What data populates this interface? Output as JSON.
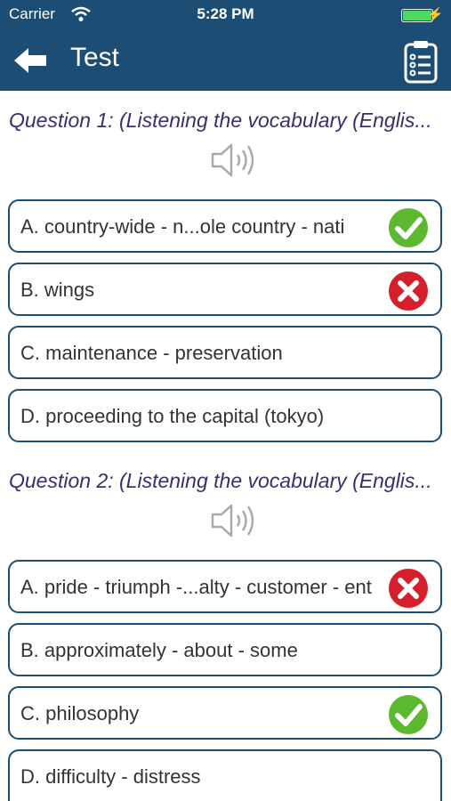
{
  "status_bar": {
    "carrier": "Carrier",
    "time": "5:28 PM"
  },
  "nav": {
    "title": "Test",
    "back_icon": "left-arrow-icon",
    "menu_icon": "clipboard-checklist-icon"
  },
  "colors": {
    "nav_bg": "#1b4d75",
    "question_text": "#3a2e6e",
    "correct": "#5cb82e",
    "wrong": "#d5202b"
  },
  "questions": [
    {
      "text": "Question 1: (Listening the vocabulary (Englis...",
      "options": [
        {
          "label": "A. country-wide - n...ole country - nati",
          "mark": "correct"
        },
        {
          "label": "B. wings",
          "mark": "wrong"
        },
        {
          "label": "C. maintenance - preservation",
          "mark": ""
        },
        {
          "label": "D. proceeding to the capital (tokyo)",
          "mark": ""
        }
      ]
    },
    {
      "text": "Question 2: (Listening the vocabulary (Englis...",
      "options": [
        {
          "label": "A. pride - triumph -...alty - customer - ent",
          "mark": "wrong"
        },
        {
          "label": "B. approximately - about - some",
          "mark": ""
        },
        {
          "label": "C. philosophy",
          "mark": "correct"
        },
        {
          "label": "D. difficulty - distress",
          "mark": ""
        }
      ]
    }
  ]
}
